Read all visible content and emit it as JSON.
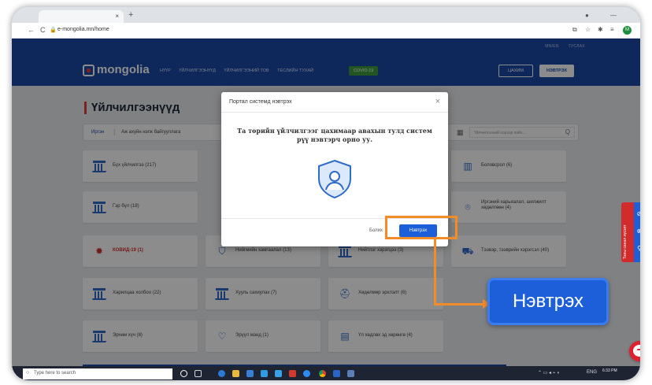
{
  "browser": {
    "tab_title": "",
    "tab_close": "×",
    "new_tab": "+",
    "url": "e-mongolia.mn/home",
    "back": "←",
    "reload": "C"
  },
  "site": {
    "brand": "mongolia",
    "top_links": [
      "MN/EN",
      "ТУСЛАХ"
    ],
    "menu": [
      "НҮҮР",
      "ҮЙЛЧИЛГЭЭНҮҮД",
      "ҮЙЛЧИЛГЭЭНИЙ ТОВ",
      "ТЕСЛИЙН ТУХАЙ"
    ],
    "covid_label": "COVID-19",
    "register_label": "ЦАХИМ",
    "login_label": "НЭВТРЭХ"
  },
  "page": {
    "title": "Үйлчилгээнүүд",
    "filter_active": "Иргэн",
    "filter_other": "Аж ахуйн нэгж байгууллага",
    "search_placeholder": "Үйлчилгээний нэрээр хайх...",
    "search_icon": "Q"
  },
  "cards": [
    {
      "label": "Бүх үйлчилгээ (217)",
      "icon": "building-icon",
      "red": false
    },
    {
      "label": "Гэр бүл (18)",
      "icon": "building-icon",
      "red": false
    },
    {
      "label": "КОВИД-19 (1)",
      "icon": "virus-icon",
      "red": true
    },
    {
      "label": "Нийгмийн хамгаалал (13)",
      "icon": "shield-icon",
      "red": false
    },
    {
      "label": "Нийтлэг хэрэгцээ (3)",
      "icon": "building-icon",
      "red": false
    },
    {
      "label": "Тээвэр, тээврийн хэрэгсэл (40)",
      "icon": "car-icon",
      "red": false
    },
    {
      "label": "Харилцаа холбоо (22)",
      "icon": "building-icon",
      "red": false
    },
    {
      "label": "Хууль сахиулах (7)",
      "icon": "building-icon",
      "red": false
    },
    {
      "label": "Хөдөлмөр эрхлэлт (6)",
      "icon": "helmet-icon",
      "red": false
    },
    {
      "label": "Эрчим хүч (8)",
      "icon": "building-icon",
      "red": false
    },
    {
      "label": "Эрүүл мэнд (1)",
      "icon": "heart-icon",
      "red": false
    },
    {
      "label": "Үл хөдлөх эд хөрөнгө (4)",
      "icon": "document-icon",
      "red": false
    },
    {
      "label": "Боловсрол (6)",
      "icon": "book-icon",
      "red": false
    },
    {
      "label": "Иргэний харьяалал, шилжилт хөдөлгөөн (4)",
      "icon": "location-icon",
      "red": false
    }
  ],
  "side_widget": {
    "label": "Таны санал хүсэлт"
  },
  "modal": {
    "title": "Портал системд нэвтрэх",
    "close": "×",
    "message": "Та төрийн үйлчилгээг цахимаар авахын тулд систем рүү нэвтэрч орно уу.",
    "cancel_label": "Болих",
    "login_label": "Нэвтрэх"
  },
  "annotation": {
    "big_button_label": "Нэвтрэх"
  },
  "taskbar": {
    "search_placeholder": "Type here to search",
    "clock": "6:33 PM",
    "lang": "ENG"
  },
  "colors": {
    "brand_blue": "#1c4aa8",
    "button_blue": "#1c5fd8",
    "highlight_orange": "#f28c28",
    "covid_green": "#3f9b3f",
    "alert_red": "#d22b2b"
  }
}
